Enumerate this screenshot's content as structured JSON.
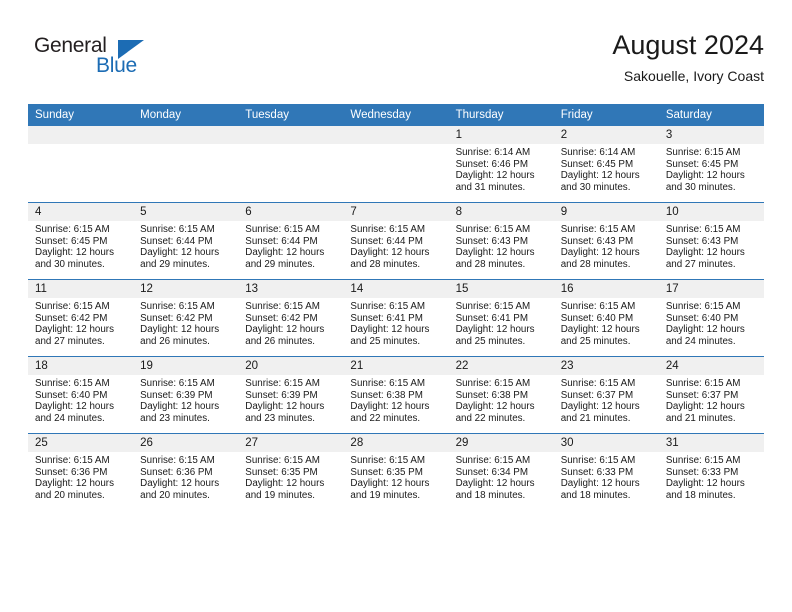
{
  "branding": {
    "logo_text_primary": "General",
    "logo_text_secondary": "Blue",
    "logo_triangle_color": "#1c6cb4",
    "logo_primary_color": "#231f20"
  },
  "header": {
    "title": "August 2024",
    "subtitle": "Sakouelle, Ivory Coast"
  },
  "theme": {
    "header_bg": "#3077b7",
    "header_text": "#ffffff",
    "daynum_band_bg": "#f0f0f0",
    "row_separator": "#3077b7",
    "cell_bg": "#ffffff",
    "text": "#1a1a1a"
  },
  "weekday_headers": [
    "Sunday",
    "Monday",
    "Tuesday",
    "Wednesday",
    "Thursday",
    "Friday",
    "Saturday"
  ],
  "weeks": [
    [
      {
        "empty": true
      },
      {
        "empty": true
      },
      {
        "empty": true
      },
      {
        "empty": true
      },
      {
        "day": "1",
        "sunrise": "Sunrise: 6:14 AM",
        "sunset": "Sunset: 6:46 PM",
        "daylight": "Daylight: 12 hours and 31 minutes."
      },
      {
        "day": "2",
        "sunrise": "Sunrise: 6:14 AM",
        "sunset": "Sunset: 6:45 PM",
        "daylight": "Daylight: 12 hours and 30 minutes."
      },
      {
        "day": "3",
        "sunrise": "Sunrise: 6:15 AM",
        "sunset": "Sunset: 6:45 PM",
        "daylight": "Daylight: 12 hours and 30 minutes."
      }
    ],
    [
      {
        "day": "4",
        "sunrise": "Sunrise: 6:15 AM",
        "sunset": "Sunset: 6:45 PM",
        "daylight": "Daylight: 12 hours and 30 minutes."
      },
      {
        "day": "5",
        "sunrise": "Sunrise: 6:15 AM",
        "sunset": "Sunset: 6:44 PM",
        "daylight": "Daylight: 12 hours and 29 minutes."
      },
      {
        "day": "6",
        "sunrise": "Sunrise: 6:15 AM",
        "sunset": "Sunset: 6:44 PM",
        "daylight": "Daylight: 12 hours and 29 minutes."
      },
      {
        "day": "7",
        "sunrise": "Sunrise: 6:15 AM",
        "sunset": "Sunset: 6:44 PM",
        "daylight": "Daylight: 12 hours and 28 minutes."
      },
      {
        "day": "8",
        "sunrise": "Sunrise: 6:15 AM",
        "sunset": "Sunset: 6:43 PM",
        "daylight": "Daylight: 12 hours and 28 minutes."
      },
      {
        "day": "9",
        "sunrise": "Sunrise: 6:15 AM",
        "sunset": "Sunset: 6:43 PM",
        "daylight": "Daylight: 12 hours and 28 minutes."
      },
      {
        "day": "10",
        "sunrise": "Sunrise: 6:15 AM",
        "sunset": "Sunset: 6:43 PM",
        "daylight": "Daylight: 12 hours and 27 minutes."
      }
    ],
    [
      {
        "day": "11",
        "sunrise": "Sunrise: 6:15 AM",
        "sunset": "Sunset: 6:42 PM",
        "daylight": "Daylight: 12 hours and 27 minutes."
      },
      {
        "day": "12",
        "sunrise": "Sunrise: 6:15 AM",
        "sunset": "Sunset: 6:42 PM",
        "daylight": "Daylight: 12 hours and 26 minutes."
      },
      {
        "day": "13",
        "sunrise": "Sunrise: 6:15 AM",
        "sunset": "Sunset: 6:42 PM",
        "daylight": "Daylight: 12 hours and 26 minutes."
      },
      {
        "day": "14",
        "sunrise": "Sunrise: 6:15 AM",
        "sunset": "Sunset: 6:41 PM",
        "daylight": "Daylight: 12 hours and 25 minutes."
      },
      {
        "day": "15",
        "sunrise": "Sunrise: 6:15 AM",
        "sunset": "Sunset: 6:41 PM",
        "daylight": "Daylight: 12 hours and 25 minutes."
      },
      {
        "day": "16",
        "sunrise": "Sunrise: 6:15 AM",
        "sunset": "Sunset: 6:40 PM",
        "daylight": "Daylight: 12 hours and 25 minutes."
      },
      {
        "day": "17",
        "sunrise": "Sunrise: 6:15 AM",
        "sunset": "Sunset: 6:40 PM",
        "daylight": "Daylight: 12 hours and 24 minutes."
      }
    ],
    [
      {
        "day": "18",
        "sunrise": "Sunrise: 6:15 AM",
        "sunset": "Sunset: 6:40 PM",
        "daylight": "Daylight: 12 hours and 24 minutes."
      },
      {
        "day": "19",
        "sunrise": "Sunrise: 6:15 AM",
        "sunset": "Sunset: 6:39 PM",
        "daylight": "Daylight: 12 hours and 23 minutes."
      },
      {
        "day": "20",
        "sunrise": "Sunrise: 6:15 AM",
        "sunset": "Sunset: 6:39 PM",
        "daylight": "Daylight: 12 hours and 23 minutes."
      },
      {
        "day": "21",
        "sunrise": "Sunrise: 6:15 AM",
        "sunset": "Sunset: 6:38 PM",
        "daylight": "Daylight: 12 hours and 22 minutes."
      },
      {
        "day": "22",
        "sunrise": "Sunrise: 6:15 AM",
        "sunset": "Sunset: 6:38 PM",
        "daylight": "Daylight: 12 hours and 22 minutes."
      },
      {
        "day": "23",
        "sunrise": "Sunrise: 6:15 AM",
        "sunset": "Sunset: 6:37 PM",
        "daylight": "Daylight: 12 hours and 21 minutes."
      },
      {
        "day": "24",
        "sunrise": "Sunrise: 6:15 AM",
        "sunset": "Sunset: 6:37 PM",
        "daylight": "Daylight: 12 hours and 21 minutes."
      }
    ],
    [
      {
        "day": "25",
        "sunrise": "Sunrise: 6:15 AM",
        "sunset": "Sunset: 6:36 PM",
        "daylight": "Daylight: 12 hours and 20 minutes."
      },
      {
        "day": "26",
        "sunrise": "Sunrise: 6:15 AM",
        "sunset": "Sunset: 6:36 PM",
        "daylight": "Daylight: 12 hours and 20 minutes."
      },
      {
        "day": "27",
        "sunrise": "Sunrise: 6:15 AM",
        "sunset": "Sunset: 6:35 PM",
        "daylight": "Daylight: 12 hours and 19 minutes."
      },
      {
        "day": "28",
        "sunrise": "Sunrise: 6:15 AM",
        "sunset": "Sunset: 6:35 PM",
        "daylight": "Daylight: 12 hours and 19 minutes."
      },
      {
        "day": "29",
        "sunrise": "Sunrise: 6:15 AM",
        "sunset": "Sunset: 6:34 PM",
        "daylight": "Daylight: 12 hours and 18 minutes."
      },
      {
        "day": "30",
        "sunrise": "Sunrise: 6:15 AM",
        "sunset": "Sunset: 6:33 PM",
        "daylight": "Daylight: 12 hours and 18 minutes."
      },
      {
        "day": "31",
        "sunrise": "Sunrise: 6:15 AM",
        "sunset": "Sunset: 6:33 PM",
        "daylight": "Daylight: 12 hours and 18 minutes."
      }
    ]
  ]
}
